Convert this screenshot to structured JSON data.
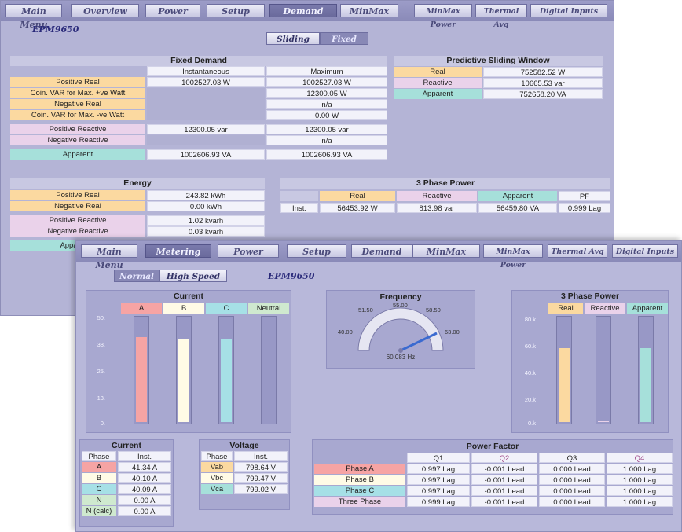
{
  "colors": {
    "real": "#fbd9a0",
    "reactive": "#ead2ea",
    "apparent": "#a6e0da",
    "phase_a": "#f6a4a4",
    "phase_b": "#fffbe6",
    "phase_c": "#a6e0e6",
    "accent": "#6a6a9c"
  },
  "win1": {
    "nav": [
      "Main Menu",
      "Overview",
      "Power",
      "Setup",
      "Demand",
      "MinMax",
      "MinMax Power",
      "Thermal Avg",
      "Digital Inputs"
    ],
    "active_nav": "Demand",
    "device": "EPM9650",
    "toggle": {
      "sliding": "Sliding",
      "fixed": "Fixed"
    },
    "fixed_demand": {
      "title": "Fixed Demand",
      "col_inst": "Instantaneous",
      "col_max": "Maximum",
      "rows": [
        {
          "label": "Positive Real",
          "inst": "1002527.03 W",
          "max": "1002527.03 W"
        },
        {
          "label": "Coin. VAR for Max. +ve Watt",
          "inst": "",
          "max": "12300.05 W"
        },
        {
          "label": "Negative Real",
          "inst": "",
          "max": "n/a"
        },
        {
          "label": "Coin. VAR for Max. -ve Watt",
          "inst": "",
          "max": "0.00 W"
        },
        {
          "label": "Positive Reactive",
          "inst": "12300.05 var",
          "max": "12300.05 var"
        },
        {
          "label": "Negative Reactive",
          "inst": "",
          "max": "n/a"
        },
        {
          "label": "Apparent",
          "inst": "1002606.93 VA",
          "max": "1002606.93 VA"
        }
      ]
    },
    "predictive": {
      "title": "Predictive Sliding Window",
      "rows": [
        {
          "label": "Real",
          "value": "752582.52 W"
        },
        {
          "label": "Reactive",
          "value": "10665.53 var"
        },
        {
          "label": "Apparent",
          "value": "752658.20 VA"
        }
      ]
    },
    "energy": {
      "title": "Energy",
      "rows": [
        {
          "label": "Positive Real",
          "value": "243.82 kWh"
        },
        {
          "label": "Negative Real",
          "value": "0.00 kWh"
        },
        {
          "label": "Positive Reactive",
          "value": "1.02 kvarh"
        },
        {
          "label": "Negative Reactive",
          "value": "0.03 kvarh"
        },
        {
          "label": "Apparent",
          "value": ""
        }
      ]
    },
    "three_phase": {
      "title": "3 Phase Power",
      "headers": [
        "Real",
        "Reactive",
        "Apparent",
        "PF"
      ],
      "row_label": "Inst.",
      "values": [
        "56453.92 W",
        "813.98 var",
        "56459.80 VA",
        "0.999 Lag"
      ]
    }
  },
  "win2": {
    "nav": [
      "Main Menu",
      "Metering",
      "Power",
      "Setup",
      "Demand",
      "MinMax",
      "MinMax Power",
      "Thermal Avg",
      "Digital Inputs"
    ],
    "active_nav": "Metering",
    "device": "EPM9650",
    "toggle": {
      "normal": "Normal",
      "high_speed": "High Speed"
    },
    "current_chart": {
      "title": "Current",
      "columns": [
        "A",
        "B",
        "C",
        "Neutral"
      ],
      "ticks": [
        "50.",
        "38.",
        "25.",
        "13.",
        "0."
      ],
      "fill": [
        0.82,
        0.8,
        0.8,
        0.0
      ]
    },
    "frequency": {
      "title": "Frequency",
      "ticks": [
        "40.00",
        "51.50",
        "55.00",
        "58.50",
        "63.00"
      ],
      "reading": "60.083 Hz",
      "value": 60.083
    },
    "power_chart": {
      "title": "3 Phase Power",
      "columns": [
        "Real",
        "Reactive",
        "Apparent"
      ],
      "ticks": [
        "80.k",
        "60.k",
        "40.k",
        "20.k",
        "0.k"
      ],
      "fill": [
        0.71,
        0.01,
        0.71
      ]
    },
    "current_table": {
      "title": "Current",
      "headers": [
        "Phase",
        "Inst."
      ],
      "rows": [
        [
          "A",
          "41.34 A"
        ],
        [
          "B",
          "40.10 A"
        ],
        [
          "C",
          "40.09 A"
        ],
        [
          "N",
          "0.00 A"
        ],
        [
          "N (calc)",
          "0.00 A"
        ]
      ]
    },
    "voltage_table": {
      "title": "Voltage",
      "headers": [
        "Phase",
        "Inst."
      ],
      "rows": [
        [
          "Vab",
          "798.64 V"
        ],
        [
          "Vbc",
          "799.47 V"
        ],
        [
          "Vca",
          "799.02 V"
        ]
      ]
    },
    "power_factor": {
      "title": "Power Factor",
      "headers": [
        "Q1",
        "Q2",
        "Q3",
        "Q4"
      ],
      "rows": [
        {
          "label": "Phase A",
          "values": [
            "0.997 Lag",
            "-0.001 Lead",
            "0.000 Lead",
            "1.000 Lag"
          ]
        },
        {
          "label": "Phase B",
          "values": [
            "0.997 Lag",
            "-0.001 Lead",
            "0.000 Lead",
            "1.000 Lag"
          ]
        },
        {
          "label": "Phase C",
          "values": [
            "0.997 Lag",
            "-0.001 Lead",
            "0.000 Lead",
            "1.000 Lag"
          ]
        },
        {
          "label": "Three Phase",
          "values": [
            "0.999 Lag",
            "-0.001 Lead",
            "0.000 Lead",
            "1.000 Lag"
          ]
        }
      ]
    }
  }
}
